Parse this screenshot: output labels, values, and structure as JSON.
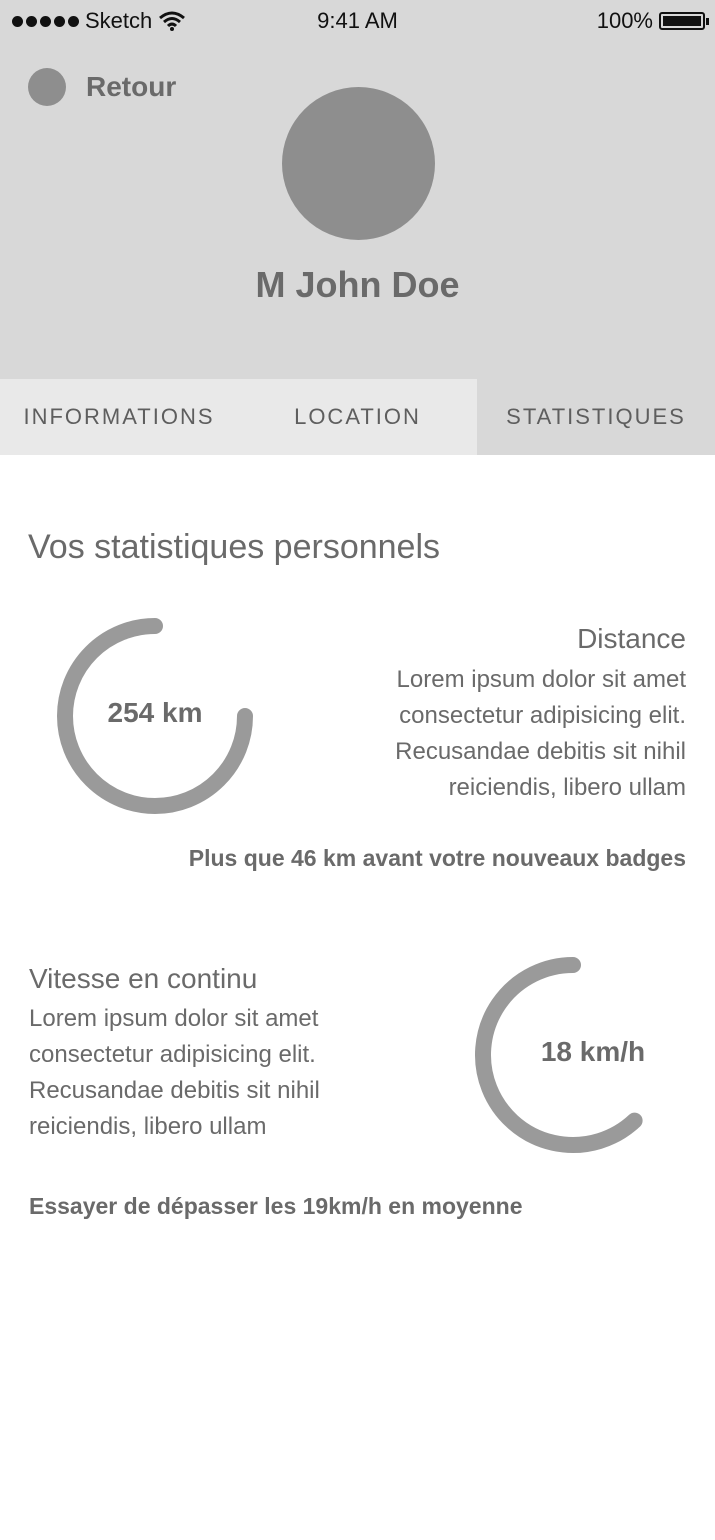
{
  "status_bar": {
    "carrier": "Sketch",
    "time": "9:41 AM",
    "battery": "100%"
  },
  "header": {
    "back_label": "Retour",
    "user_name": "M John Doe"
  },
  "tabs": [
    {
      "label": "INFORMATIONS"
    },
    {
      "label": "LOCATION"
    },
    {
      "label": "STATISTIQUES"
    }
  ],
  "main": {
    "title": "Vos statistiques personnels",
    "distance": {
      "value_label": "254 km",
      "progress": 0.75,
      "heading": "Distance",
      "lines": [
        "Lorem ipsum dolor sit amet",
        "consectetur adipisicing elit.",
        "Recusandae debitis sit nihil",
        "reiciendis, libero ullam"
      ],
      "note": "Plus que 46 km avant votre nouveaux badges"
    },
    "speed": {
      "value_label": "18 km/h",
      "progress": 0.62,
      "heading": "Vitesse en continu",
      "lines": [
        "Lorem ipsum dolor sit amet",
        "consectetur adipisicing elit.",
        "Recusandae debitis sit nihil",
        "reiciendis, libero ullam"
      ],
      "note": "Essayer de dépasser les 19km/h en moyenne"
    }
  },
  "colors": {
    "header_bg": "#d8d8d8",
    "tab_bg": "#e9e9e9",
    "active_tab_bg": "#d8d8d8",
    "gauge": "#9a9a9a",
    "text": "#6a6a6a"
  }
}
